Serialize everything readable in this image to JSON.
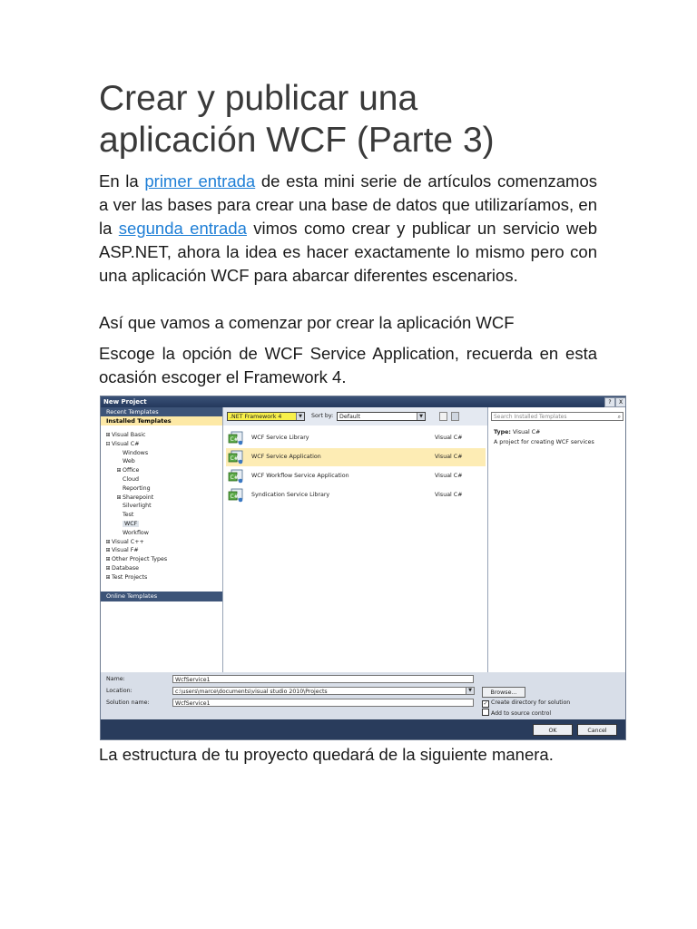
{
  "article": {
    "title_line1": "Crear y publicar una",
    "title_line2": "aplicación WCF (Parte 3)",
    "p1_before": "En la ",
    "p1_link1": "primer entrada",
    "p1_mid": " de esta mini serie de artículos comenzamos a ver las bases para crear una base de datos que utilizaríamos, en la ",
    "p1_link2": "segunda entrada",
    "p1_after": " vimos como crear y publicar un servicio web ASP.NET, ahora la idea es hacer exactamente lo mismo pero con una aplicación WCF para abarcar diferentes escenarios.",
    "p2": "Así que vamos a comenzar por crear la aplicación WCF",
    "p3": "Escoge la opción de WCF Service Application, recuerda en esta ocasión escoger el Framework 4.",
    "p4": "La estructura de tu proyecto quedará de la siguiente manera."
  },
  "dialog": {
    "title": "New Project",
    "help_btn": "?",
    "close_btn": "X",
    "recent_templates": "Recent Templates",
    "installed_templates": "Installed Templates",
    "tree": [
      {
        "label": "Visual Basic",
        "indent": 1,
        "exp": "⊞"
      },
      {
        "label": "Visual C#",
        "indent": 1,
        "exp": "⊟"
      },
      {
        "label": "Windows",
        "indent": 2,
        "exp": ""
      },
      {
        "label": "Web",
        "indent": 2,
        "exp": ""
      },
      {
        "label": "Office",
        "indent": 2,
        "exp": "⊞"
      },
      {
        "label": "Cloud",
        "indent": 2,
        "exp": ""
      },
      {
        "label": "Reporting",
        "indent": 2,
        "exp": ""
      },
      {
        "label": "Sharepoint",
        "indent": 2,
        "exp": "⊞"
      },
      {
        "label": "Silverlight",
        "indent": 2,
        "exp": ""
      },
      {
        "label": "Test",
        "indent": 2,
        "exp": ""
      },
      {
        "label": "WCF",
        "indent": 2,
        "exp": "",
        "selected": true
      },
      {
        "label": "Workflow",
        "indent": 2,
        "exp": ""
      },
      {
        "label": "Visual C++",
        "indent": 1,
        "exp": "⊞"
      },
      {
        "label": "Visual F#",
        "indent": 1,
        "exp": "⊞"
      },
      {
        "label": "Other Project Types",
        "indent": 1,
        "exp": "⊞"
      },
      {
        "label": "Database",
        "indent": 1,
        "exp": "⊞"
      },
      {
        "label": "Test Projects",
        "indent": 1,
        "exp": "⊞"
      }
    ],
    "online_templates": "Online Templates",
    "framework": ".NET Framework 4",
    "sort_by_label": "Sort by:",
    "sort_by_value": "Default",
    "templates": [
      {
        "name": "WCF Service Library",
        "lang": "Visual C#",
        "selected": false
      },
      {
        "name": "WCF Service Application",
        "lang": "Visual C#",
        "selected": true
      },
      {
        "name": "WCF Workflow Service Application",
        "lang": "Visual C#",
        "selected": false
      },
      {
        "name": "Syndication Service Library",
        "lang": "Visual C#",
        "selected": false
      }
    ],
    "search_placeholder": "Search Installed Templates",
    "type_label": "Type:",
    "type_value": "Visual C#",
    "description": "A project for creating WCF services",
    "name_label": "Name:",
    "name_value": "WcfService1",
    "location_label": "Location:",
    "location_value": "c:\\users\\marce\\documents\\visual studio 2010\\Projects",
    "solution_label": "Solution name:",
    "solution_value": "WcfService1",
    "browse": "Browse...",
    "create_dir": "Create directory for solution",
    "add_source": "Add to source control",
    "ok": "OK",
    "cancel": "Cancel"
  }
}
